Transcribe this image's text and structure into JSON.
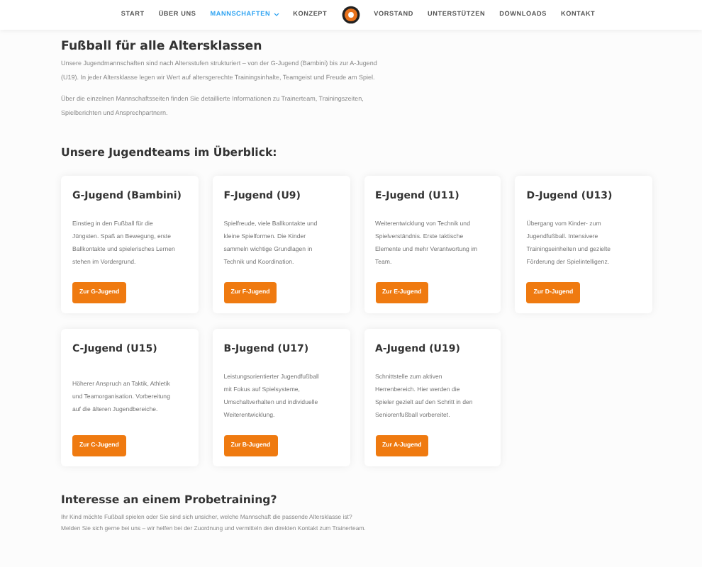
{
  "nav": {
    "items": [
      {
        "label": "START",
        "selected": false
      },
      {
        "label": "ÜBER UNS",
        "selected": false
      },
      {
        "label": "MANNSCHAFTEN",
        "selected": true,
        "dropdown": true
      },
      {
        "label": "KONZEPT",
        "selected": false
      },
      {
        "kind": "logo"
      },
      {
        "label": "VORSTAND",
        "selected": false
      },
      {
        "label": "UNTERSTÜTZEN",
        "selected": false
      },
      {
        "label": "DOWNLOADS",
        "selected": false
      },
      {
        "label": "KONTAKT",
        "selected": false
      }
    ]
  },
  "intro": {
    "title": "Fußball für alle Altersklassen",
    "paragraphs": [
      "Unsere Jugendmannschaften sind nach Altersstufen strukturiert – von der G-Jugend (Bambini) bis zur A-Jugend (U19). In jeder Altersklasse legen wir Wert auf altersgerechte Trainingsinhalte, Teamgeist und Freude am Spiel.",
      "Über die einzelnen Mannschaftsseiten finden Sie detaillierte Informationen zu Trainerteam, Trainingszeiten, Spielberichten und Ansprechpartnern."
    ]
  },
  "teams": {
    "title": "Unsere Jugendteams im Überblick:",
    "cards": [
      {
        "title": "G-Jugend (Bambini)",
        "text": "Einstieg in den Fußball für die Jüngsten. Spaß an Bewegung, erste Ballkontakte und spielerisches Lernen stehen im Vordergrund.",
        "button": "Zur G-Jugend"
      },
      {
        "title": "F-Jugend (U9)",
        "text": "Spielfreude, viele Ballkontakte und kleine Spielformen. Die Kinder sammeln wichtige Grundlagen in Technik und Koordination.",
        "button": "Zur F-Jugend"
      },
      {
        "title": "E-Jugend (U11)",
        "text": "Weiterentwicklung von Technik und Spielverständnis. Erste taktische Elemente und mehr Verantwortung im Team.",
        "button": "Zur E-Jugend"
      },
      {
        "title": "D-Jugend (U13)",
        "text": "Übergang vom Kinder- zum Jugendfußball. Intensivere Trainingseinheiten und gezielte Förderung der Spielintelligenz.",
        "button": "Zur D-Jugend"
      },
      {
        "title": "C-Jugend (U15)",
        "text": "Höherer Anspruch an Taktik, Athletik und Teamorganisation. Vorbereitung auf die älteren Jugendbereiche.",
        "button": "Zur C-Jugend"
      },
      {
        "title": "B-Jugend (U17)",
        "text": "Leistungsorientierter Jugendfußball mit Fokus auf Spielsysteme, Umschaltverhalten und individuelle Weiterentwicklung.",
        "button": "Zur B-Jugend"
      },
      {
        "title": "A-Jugend (U19)",
        "text": "Schnittstelle zum aktiven Herrenbereich. Hier werden die Spieler gezielt auf den Schritt in den Seniorenfußball vorbereitet.",
        "button": "Zur A-Jugend"
      }
    ]
  },
  "trial": {
    "title": "Interesse an einem Probetraining?",
    "lines": [
      "Ihr Kind möchte Fußball spielen oder Sie sind sich unsicher, welche Mannschaft die passende Altersklasse ist?",
      "Melden Sie sich gerne bei uns – wir helfen bei der Zuordnung und vermitteln den direkten Kontakt zum Trainerteam."
    ]
  }
}
